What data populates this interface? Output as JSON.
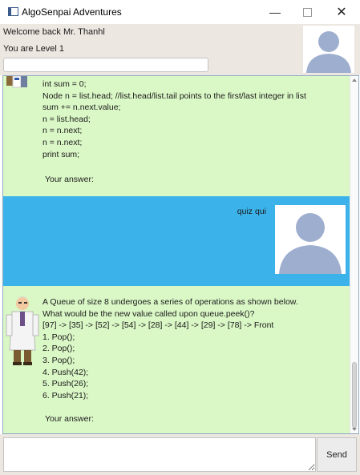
{
  "window": {
    "title": "AlgoSenpai Adventures",
    "minimize_glyph": "—",
    "close_glyph": "✕"
  },
  "header": {
    "welcome": "Welcome back Mr. Thanhl",
    "level": "You are Level 1",
    "input_value": ""
  },
  "chat": {
    "messages": [
      {
        "sender": "bot",
        "lines": [
          "int sum = 0;",
          "Node n = list.head; //list.head/list.tail points to the first/last integer in list",
          "sum += n.next.value;",
          "n = list.head;",
          "n = n.next;",
          "n = n.next;",
          "print sum;"
        ],
        "answer_prompt": "Your answer:"
      },
      {
        "sender": "user",
        "text": "quiz qui"
      },
      {
        "sender": "bot",
        "lines": [
          "A Queue of size 8 undergoes a series of operations as shown below.",
          "What would be the new value called upon queue.peek()?",
          "[97] -> [35] -> [52] -> [54] -> [28] -> [44] -> [29] -> [78] -> Front",
          "1. Pop();",
          "2. Pop();",
          "3. Pop();",
          "4. Push(42);",
          "5. Push(26);",
          "6. Push(21);"
        ],
        "answer_prompt": "Your answer:"
      }
    ]
  },
  "input": {
    "value": "",
    "send_label": "Send"
  },
  "colors": {
    "bot_bubble": "#daf7c6",
    "user_bubble": "#3bb3ea",
    "header_bg": "#ede7e1",
    "avatar_silhouette": "#9eaecf"
  },
  "icons": {
    "app": "app-window-icon",
    "user_avatar": "user-silhouette-icon",
    "bot_avatar": "professor-icon"
  }
}
